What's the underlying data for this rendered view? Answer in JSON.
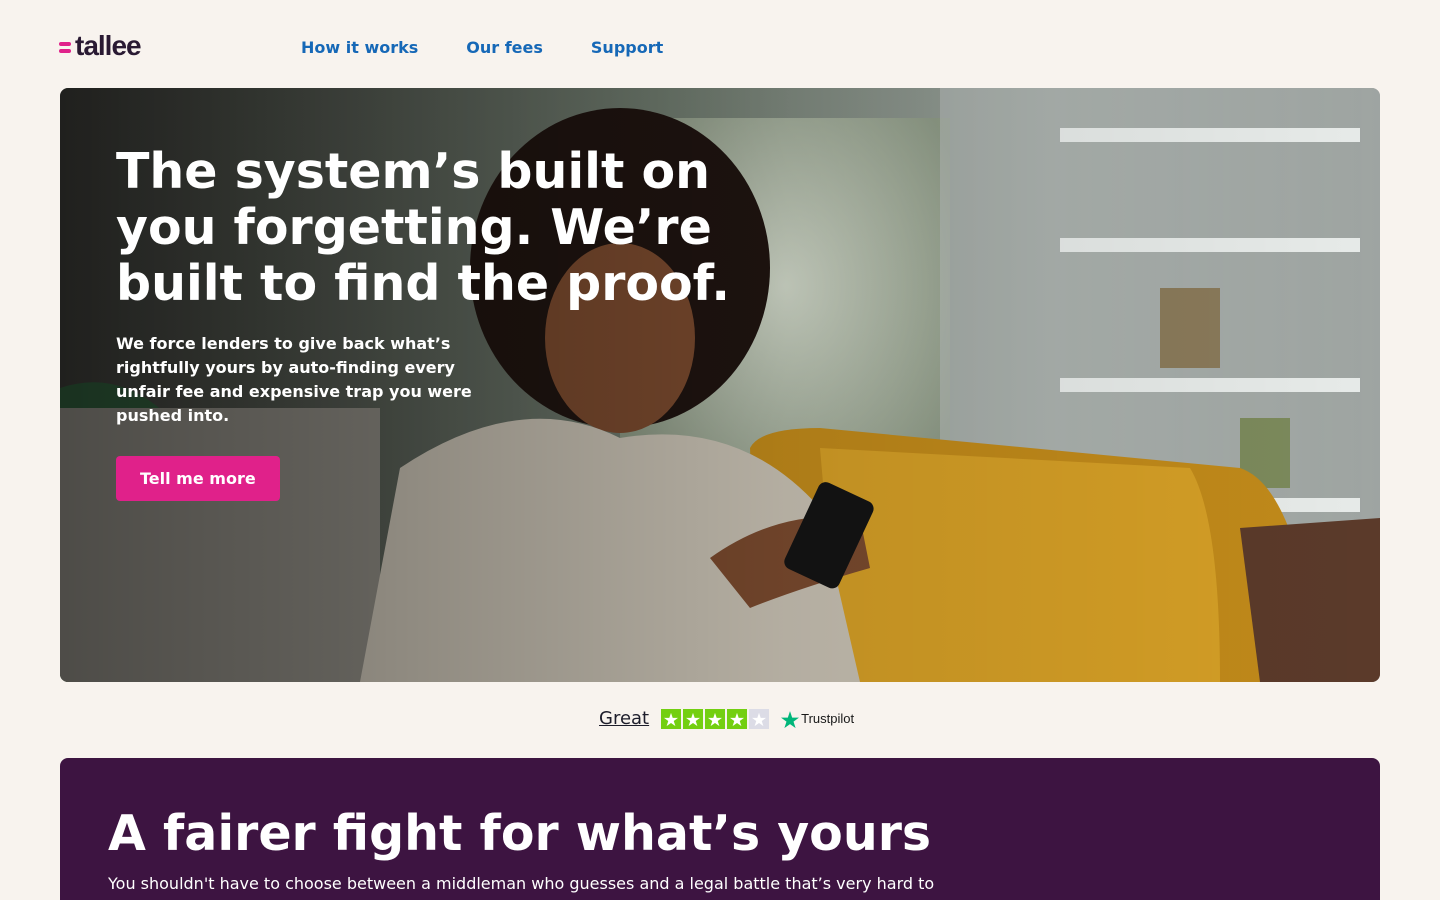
{
  "header": {
    "logo_text": "tallee",
    "nav": [
      "How it works",
      "Our fees",
      "Support"
    ]
  },
  "hero": {
    "title": "The system’s built on you forgetting. We’re built to find the proof.",
    "subtitle": "We force lenders to give back what’s rightfully yours by auto-finding every unfair fee and expensive trap you were pushed into.",
    "cta_label": "Tell me more"
  },
  "trustpilot": {
    "rating_word": "Great",
    "stars_filled": 4,
    "stars_total": 5,
    "brand": "Trustpilot"
  },
  "section": {
    "title": "A fairer fight for what’s yours",
    "text": "You shouldn't have to choose between a middleman who guesses and a legal battle that’s very hard to"
  },
  "colors": {
    "background": "#f8f3ee",
    "accent_pink": "#e0218a",
    "nav_blue": "#1668b7",
    "panel_purple": "#3d1441",
    "trustpilot_green": "#00b67a",
    "star_filled": "#73cf11",
    "star_empty": "#dcdce6"
  },
  "icons": {
    "logo_mark": "double-dash-icon",
    "trustpilot": "trustpilot-star-icon"
  }
}
